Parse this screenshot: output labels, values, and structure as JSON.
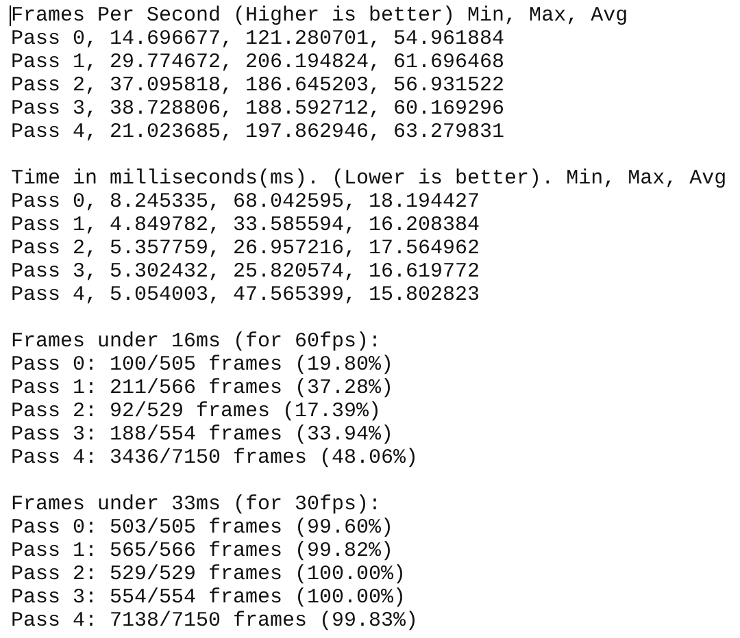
{
  "document": {
    "sections": [
      {
        "header": "Frames Per Second (Higher is better) Min, Max, Avg",
        "lines": [
          "Pass 0, 14.696677, 121.280701, 54.961884",
          "Pass 1, 29.774672, 206.194824, 61.696468",
          "Pass 2, 37.095818, 186.645203, 56.931522",
          "Pass 3, 38.728806, 188.592712, 60.169296",
          "Pass 4, 21.023685, 197.862946, 63.279831"
        ]
      },
      {
        "header": "Time in milliseconds(ms). (Lower is better). Min, Max, Avg",
        "lines": [
          "Pass 0, 8.245335, 68.042595, 18.194427",
          "Pass 1, 4.849782, 33.585594, 16.208384",
          "Pass 2, 5.357759, 26.957216, 17.564962",
          "Pass 3, 5.302432, 25.820574, 16.619772",
          "Pass 4, 5.054003, 47.565399, 15.802823"
        ]
      },
      {
        "header": "Frames under 16ms (for 60fps):",
        "lines": [
          "Pass 0: 100/505 frames (19.80%)",
          "Pass 1: 211/566 frames (37.28%)",
          "Pass 2: 92/529 frames (17.39%)",
          "Pass 3: 188/554 frames (33.94%)",
          "Pass 4: 3436/7150 frames (48.06%)"
        ]
      },
      {
        "header": "Frames under 33ms (for 30fps):",
        "lines": [
          "Pass 0: 503/505 frames (99.60%)",
          "Pass 1: 565/566 frames (99.82%)",
          "Pass 2: 529/529 frames (100.00%)",
          "Pass 3: 554/554 frames (100.00%)",
          "Pass 4: 7138/7150 frames (99.83%)"
        ]
      }
    ]
  }
}
